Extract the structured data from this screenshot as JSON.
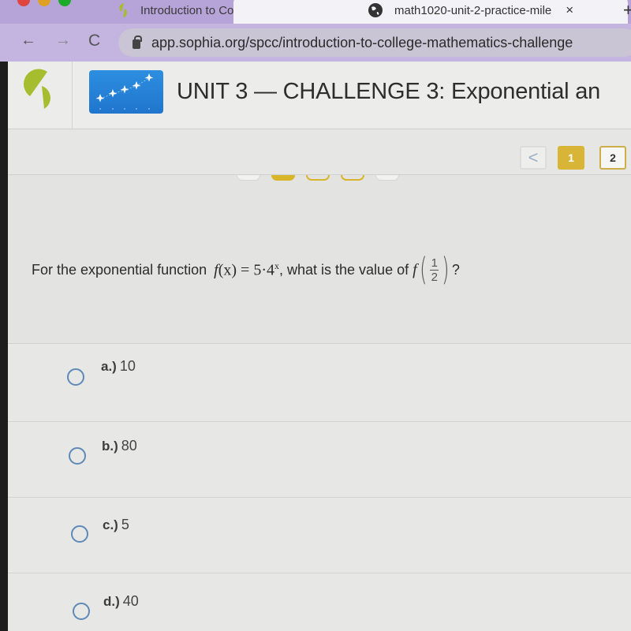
{
  "browser": {
    "tabs": [
      {
        "title": "Introduction to College Mathen",
        "close": "×",
        "active": false
      },
      {
        "title": "math1020-unit-2-practice-mile",
        "close": "×",
        "active": true
      }
    ],
    "new_tab": "+",
    "nav": {
      "back": "←",
      "forward": "→",
      "reload": "C"
    },
    "url": "app.sophia.org/spcc/introduction-to-college-mathematics-challenge"
  },
  "header": {
    "title": "UNIT 3 — CHALLENGE 3: Exponential an",
    "logo_color": "#a5bd2f",
    "thumbnail_color": "#2684d8"
  },
  "pagination": {
    "prev": "<",
    "pages": [
      "1",
      "2"
    ],
    "current": "1",
    "accent": "#d8b437"
  },
  "progress_dots": [
    "empty",
    "filled",
    "partial",
    "partial",
    "empty"
  ],
  "question": {
    "prefix": "For the exponential function ",
    "func_name": "f",
    "func_arg": "(x)",
    "equals": " = 5·4",
    "exponent": "x",
    "middle": ", what is the value of ",
    "eval_func": "f",
    "frac_num": "1",
    "frac_den": "2",
    "suffix": "?"
  },
  "answers": [
    {
      "letter": "a.)",
      "value": "10"
    },
    {
      "letter": "b.)",
      "value": "80"
    },
    {
      "letter": "c.)",
      "value": "5"
    },
    {
      "letter": "d.)",
      "value": "40"
    }
  ]
}
